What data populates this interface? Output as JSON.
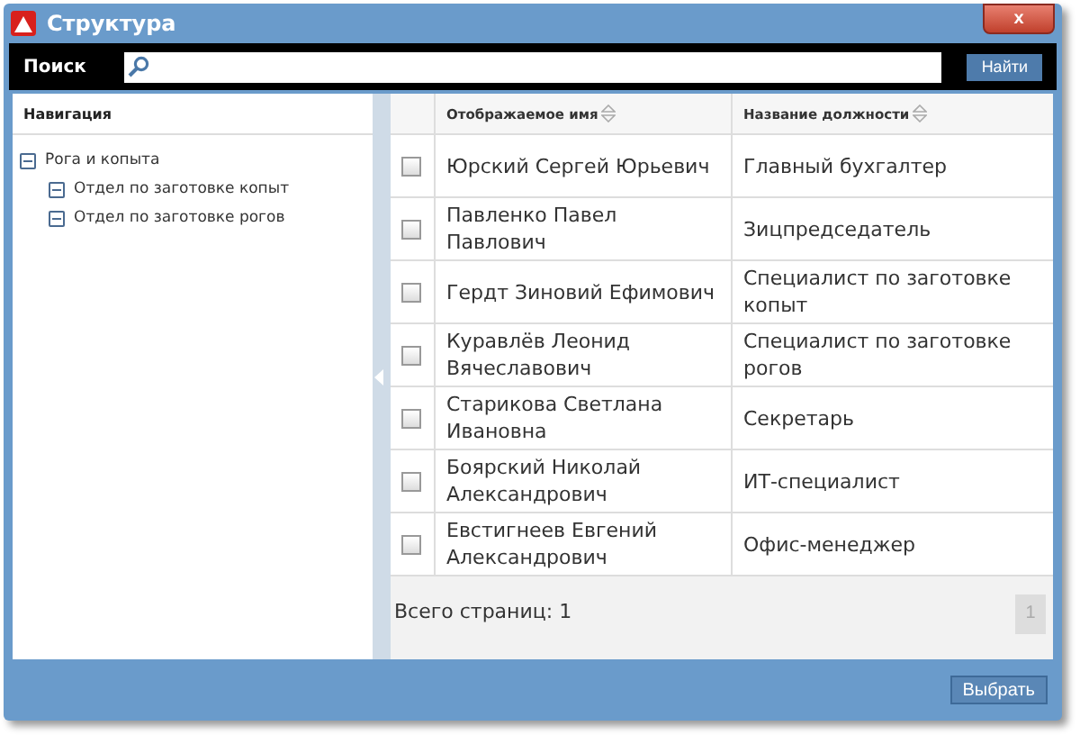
{
  "window": {
    "title": "Структура",
    "close": "x"
  },
  "search": {
    "label": "Поиск",
    "button": "Найти"
  },
  "navigation": {
    "title": "Навигация",
    "tree": [
      {
        "label": "Рога и копыта",
        "expanded": true,
        "children": [
          {
            "label": "Отдел по заготовке копыт",
            "expanded": true
          },
          {
            "label": "Отдел по заготовке рогов",
            "expanded": true
          }
        ]
      }
    ]
  },
  "table": {
    "columns": [
      "Отображаемое имя",
      "Название должности"
    ],
    "rows": [
      {
        "checked": false,
        "name": "Юрский Сергей Юрьевич",
        "position": "Главный бухгалтер"
      },
      {
        "checked": false,
        "name": "Павленко Павел Павлович",
        "position": "Зицпредседатель"
      },
      {
        "checked": false,
        "name": "Гердт Зиновий Ефимович",
        "position": "Специалист по заготовке копыт"
      },
      {
        "checked": false,
        "name": "Куравлёв Леонид Вячеславович",
        "position": "Специалист по заготовке рогов"
      },
      {
        "checked": false,
        "name": "Старикова Светлана Ивановна",
        "position": "Секретарь"
      },
      {
        "checked": false,
        "name": "Боярский Николай Александрович",
        "position": "ИТ-специалист"
      },
      {
        "checked": false,
        "name": "Евстигнеев Евгений Александрович",
        "position": "Офис-менеджер"
      }
    ]
  },
  "pager": {
    "summary": "Всего страниц: 1",
    "pages": [
      {
        "label": "1",
        "selected": true
      }
    ]
  },
  "footer": {
    "button": "Выбрать"
  }
}
